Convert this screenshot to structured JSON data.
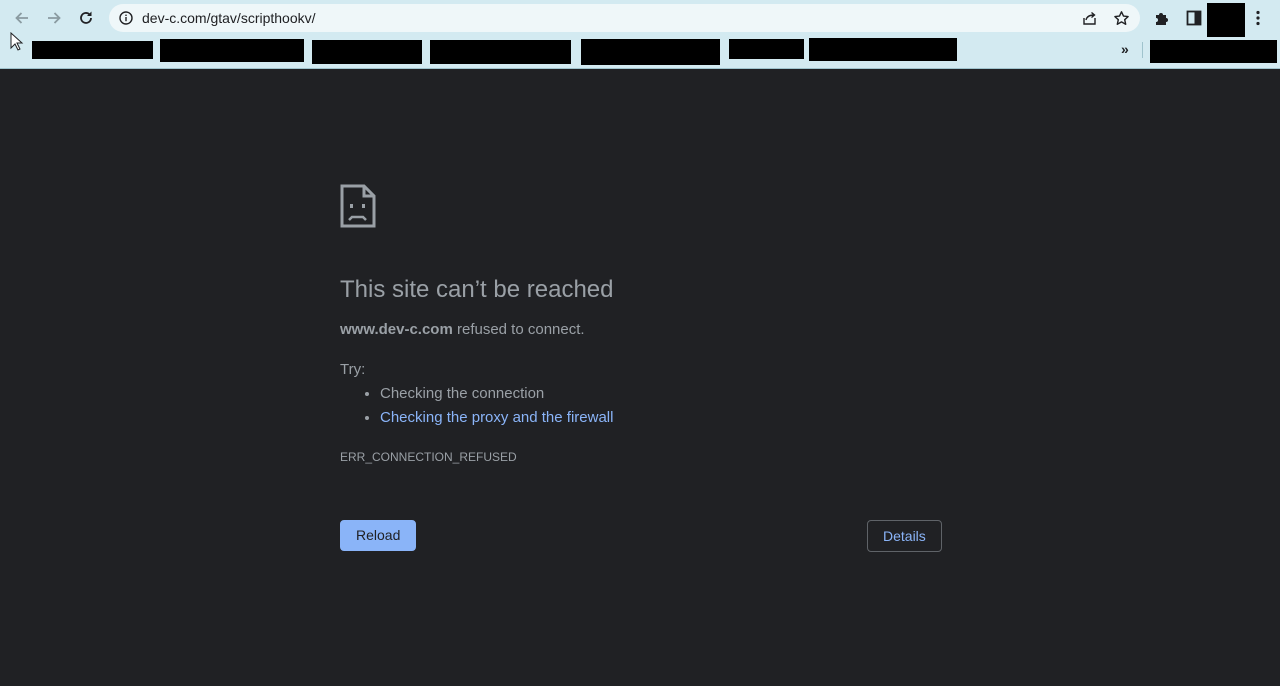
{
  "browser": {
    "url": "dev-c.com/gtav/scripthookv/",
    "more_bookmarks_label": "»"
  },
  "icons": {
    "back": "arrow-left-icon",
    "forward": "arrow-right-icon",
    "reload": "reload-icon",
    "site_info": "info-icon",
    "share": "share-icon",
    "bookmark": "star-icon",
    "extensions": "puzzle-icon",
    "side_panel": "side-panel-icon",
    "menu": "kebab-menu-icon",
    "error": "sad-page-icon"
  },
  "error_page": {
    "title": "This site can’t be reached",
    "host": "www.dev-c.com",
    "message": " refused to connect.",
    "try_label": "Try:",
    "suggestions": [
      "Checking the connection",
      "Checking the proxy and the firewall"
    ],
    "error_code": "ERR_CONNECTION_REFUSED",
    "reload_label": "Reload",
    "details_label": "Details"
  },
  "colors": {
    "chrome_bg": "#d3eaf1",
    "page_bg": "#202124",
    "text": "#9aa0a6",
    "link": "#8ab4f8"
  }
}
